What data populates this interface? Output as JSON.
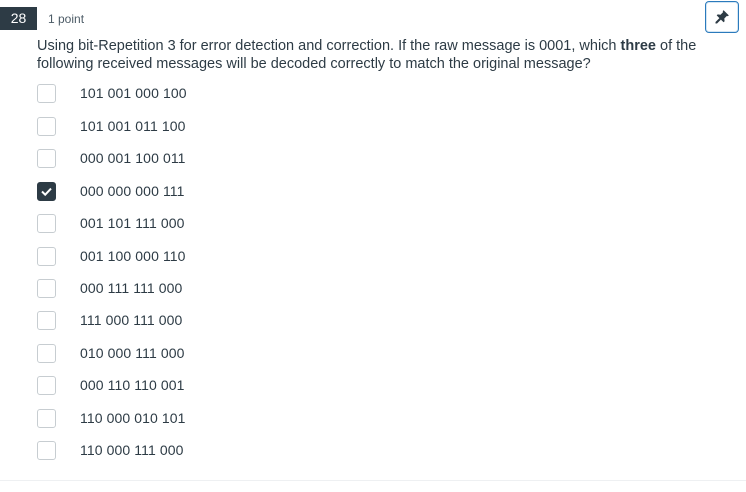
{
  "question": {
    "number": "28",
    "points": "1 point",
    "text_before": "Using bit-Repetition 3 for error detection and correction. If the raw message is 0001, which ",
    "text_bold": "three",
    "text_after": " of the following received messages will be decoded correctly to match the original message?",
    "pin_icon": "pin-icon"
  },
  "options": [
    {
      "label": "101 001 000 100",
      "checked": false
    },
    {
      "label": "101 001 011 100",
      "checked": false
    },
    {
      "label": "000 001 100 011",
      "checked": false
    },
    {
      "label": "000 000 000 111",
      "checked": true
    },
    {
      "label": "001 101 111 000",
      "checked": false
    },
    {
      "label": "001 100 000 110",
      "checked": false
    },
    {
      "label": "000 111 111 000",
      "checked": false
    },
    {
      "label": "111 000 111 000",
      "checked": false
    },
    {
      "label": "010 000 111 000",
      "checked": false
    },
    {
      "label": "000 110 110 001",
      "checked": false
    },
    {
      "label": "110 000 010 101",
      "checked": false
    },
    {
      "label": "110 000 111 000",
      "checked": false
    }
  ],
  "colors": {
    "accent": "#2b7abc",
    "dark": "#2d3b45"
  }
}
